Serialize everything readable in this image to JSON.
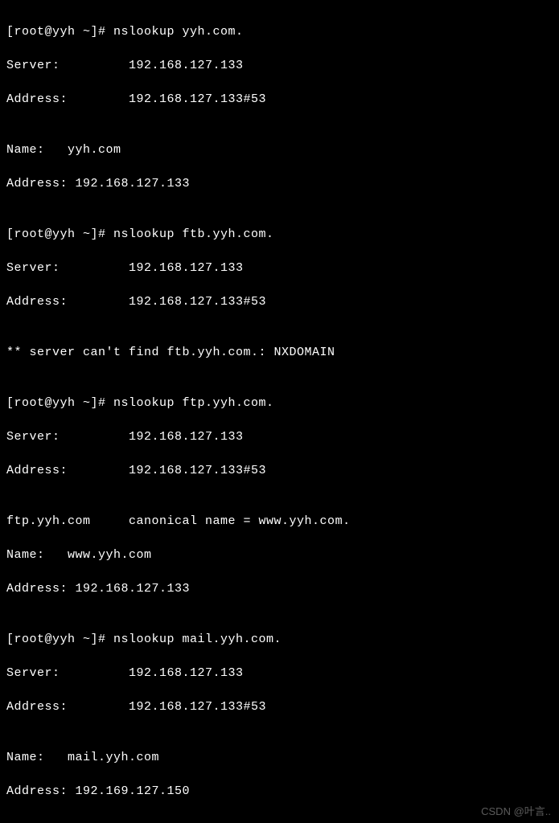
{
  "terminal": {
    "lines": {
      "l01": "[root@yyh ~]# nslookup yyh.com.",
      "l02": "Server:         192.168.127.133",
      "l03": "Address:        192.168.127.133#53",
      "l04": "",
      "l05": "Name:   yyh.com",
      "l06": "Address: 192.168.127.133",
      "l07": "",
      "l08": "[root@yyh ~]# nslookup ftb.yyh.com.",
      "l09": "Server:         192.168.127.133",
      "l10": "Address:        192.168.127.133#53",
      "l11": "",
      "l12": "** server can't find ftb.yyh.com.: NXDOMAIN",
      "l13": "",
      "l14": "[root@yyh ~]# nslookup ftp.yyh.com.",
      "l15": "Server:         192.168.127.133",
      "l16": "Address:        192.168.127.133#53",
      "l17": "",
      "l18": "ftp.yyh.com     canonical name = www.yyh.com.",
      "l19": "Name:   www.yyh.com",
      "l20": "Address: 192.168.127.133",
      "l21": "",
      "l22": "[root@yyh ~]# nslookup mail.yyh.com.",
      "l23": "Server:         192.168.127.133",
      "l24": "Address:        192.168.127.133#53",
      "l25": "",
      "l26": "Name:   mail.yyh.com",
      "l27": "Address: 192.169.127.150"
    }
  },
  "watermark": "CSDN @叶言.."
}
